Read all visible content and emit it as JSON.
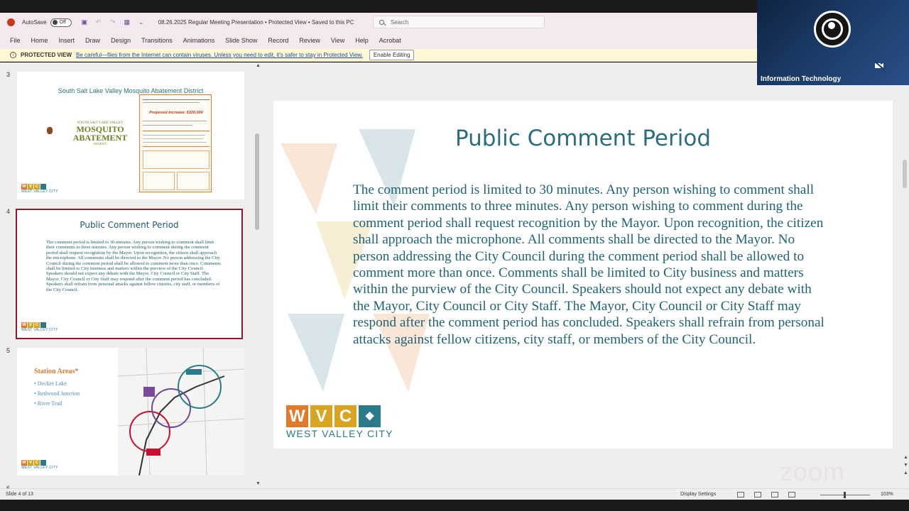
{
  "titlebar": {
    "autosave": "AutoSave",
    "autosave_state": "Off",
    "doc_title": "08.26.2025 Regular Meeting Presentation  •  Protected View  •  Saved to this PC",
    "search_placeholder": "Search"
  },
  "ribbon": {
    "tabs": [
      "File",
      "Home",
      "Insert",
      "Draw",
      "Design",
      "Transitions",
      "Animations",
      "Slide Show",
      "Record",
      "Review",
      "View",
      "Help",
      "Acrobat"
    ]
  },
  "protected": {
    "label": "PROTECTED VIEW",
    "message": "Be careful—files from the Internet can contain viruses. Unless you need to edit, it's safer to stay in Protected View.",
    "button": "Enable Editing"
  },
  "thumbnails": {
    "t3": {
      "num": "3",
      "title": "South Salt Lake Valley Mosquito Abatement District",
      "logo_line1": "SOUTH SALT LAKE VALLEY",
      "logo_line2": "MOSQUITO",
      "logo_line3": "ABATEMENT",
      "logo_line4": "DISTRICT",
      "fs_increase": "Proposed Increase: $320,000"
    },
    "t4": {
      "num": "4",
      "title": "Public Comment Period"
    },
    "t5": {
      "num": "5",
      "title": "Station Areas*",
      "items": [
        "• Decker Lake",
        "• Redwood Junction",
        "• River Trail"
      ]
    },
    "t6": {
      "num": "6"
    }
  },
  "slide": {
    "title": "Public Comment Period",
    "body": "The comment period is limited to 30 minutes.  Any person wishing to comment shall limit their comments to three minutes.  Any person wishing to comment during the comment period shall request recognition by the Mayor.  Upon recognition, the citizen shall approach the microphone.    All comments shall be directed to the Mayor. No person addressing the City Council during the comment period shall be allowed to comment more than once. Comments shall be limited to City business and matters within the purview of the City Council.   Speakers should not expect any debate with the Mayor, City Council or City Staff. The Mayor, City Council or City Staff may respond after the comment period has concluded. Speakers shall refrain from personal attacks against fellow citizens, city staff, or members of the City Council.",
    "logo_letters": [
      "W",
      "V",
      "C"
    ],
    "logo_name": "WEST VALLEY CITY",
    "mini_logo_name": "WEST VALLEY CITY"
  },
  "status": {
    "slide_of": "Slide 4 of 13",
    "display_settings": "Display Settings",
    "zoom": "103%"
  },
  "video": {
    "participant": "Information Technology"
  },
  "watermark": "zoom",
  "colors": {
    "accent": "#8a1a2c",
    "title_teal": "#2a6e7e",
    "logo_orange": "#e07a2a",
    "logo_gold": "#d9a520",
    "logo_teal": "#2b7a8a"
  }
}
